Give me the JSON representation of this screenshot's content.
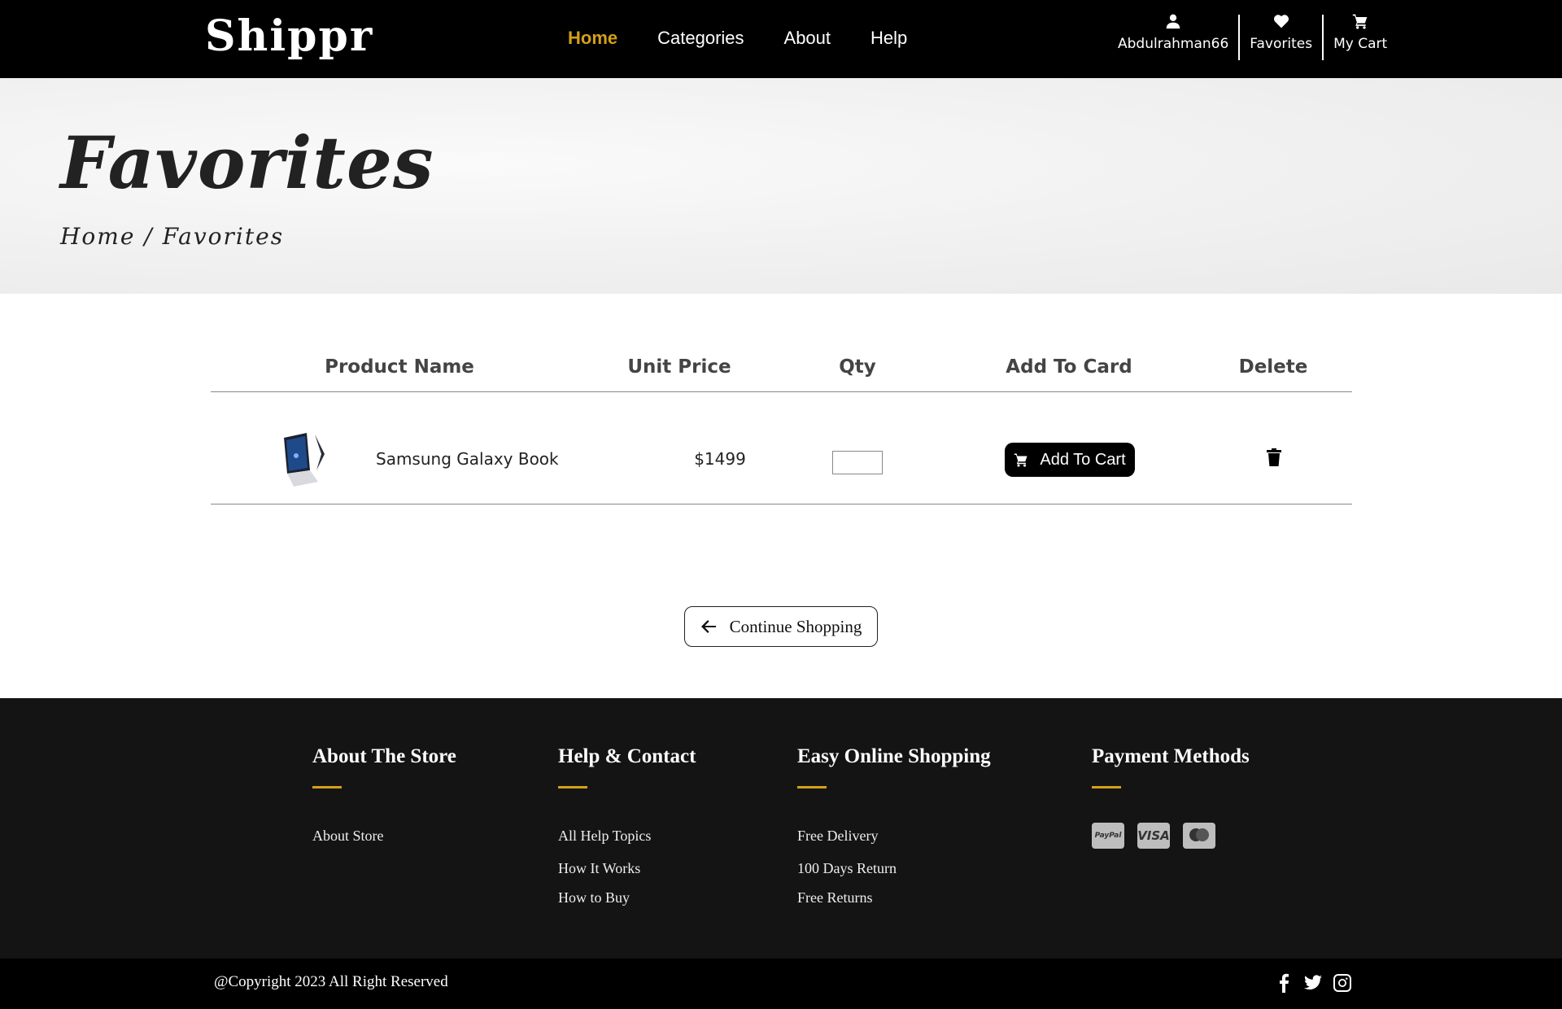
{
  "header": {
    "brand": "Shippr",
    "nav": [
      {
        "label": "Home",
        "active": true
      },
      {
        "label": "Categories",
        "active": false
      },
      {
        "label": "About",
        "active": false
      },
      {
        "label": "Help",
        "active": false
      }
    ],
    "user": {
      "name": "Abdulrahman66",
      "icon": "user-icon"
    },
    "favorites": {
      "label": "Favorites",
      "icon": "heart-icon"
    },
    "cart": {
      "label": "My Cart",
      "icon": "cart-icon"
    }
  },
  "hero": {
    "title": "Favorites",
    "breadcrumb": "Home / Favorites"
  },
  "table": {
    "headers": {
      "product": "Product Name",
      "price": "Unit Price",
      "qty": "Qty",
      "add": "Add To Card",
      "delete": "Delete"
    },
    "rows": [
      {
        "name": "Samsung Galaxy Book",
        "price": "$1499",
        "qty": "",
        "add_label": "Add To Cart",
        "image_icon": "laptop-image",
        "delete_icon": "trash-icon"
      }
    ]
  },
  "continue": {
    "label": "Continue Shopping",
    "icon": "arrow-left-icon"
  },
  "footer": {
    "columns": [
      {
        "title": "About The Store",
        "links": [
          "About Store"
        ]
      },
      {
        "title": "Help & Contact",
        "links": [
          "All Help Topics",
          "How It Works",
          "How to Buy"
        ]
      },
      {
        "title": "Easy Online Shopping",
        "links": [
          "Free Delivery",
          "100 Days Return",
          "Free Returns"
        ]
      },
      {
        "title": "Payment Methods",
        "payments": [
          "PayPal",
          "VISA",
          "mastercard"
        ]
      }
    ],
    "copyright": "@Copyright 2023 All Right Reserved",
    "social": [
      "facebook-icon",
      "twitter-icon",
      "instagram-icon"
    ]
  },
  "colors": {
    "accent": "#d4a017",
    "header_bg": "#000000",
    "footer_bg": "#141414"
  }
}
